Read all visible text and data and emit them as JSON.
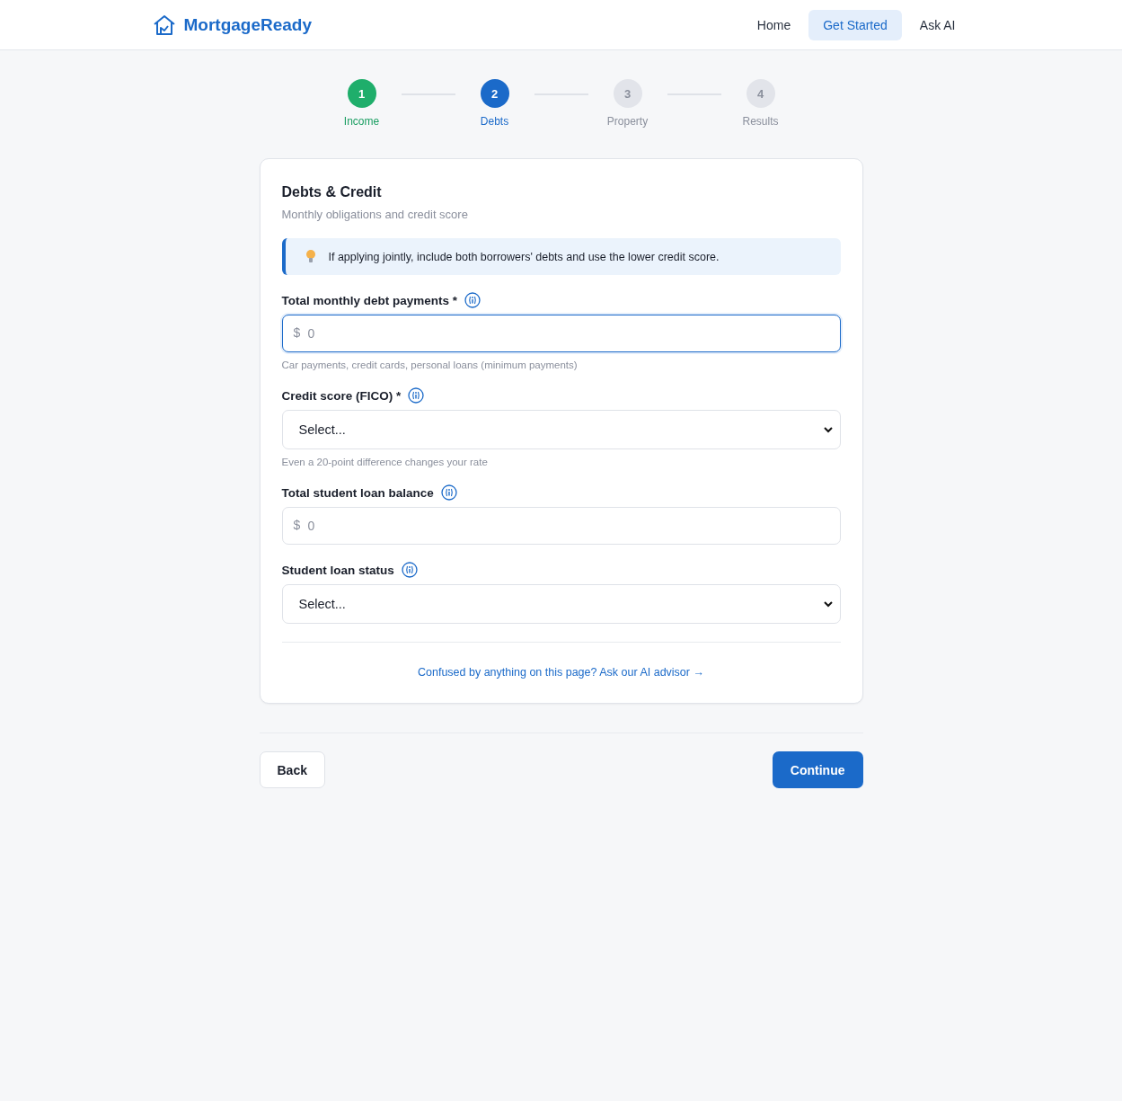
{
  "header": {
    "logo": "MortgageReady",
    "nav": [
      {
        "label": "Home",
        "selected": false
      },
      {
        "label": "Get Started",
        "selected": true
      },
      {
        "label": "Ask AI",
        "selected": false
      }
    ]
  },
  "steps": [
    {
      "number": "1",
      "label": "Income",
      "completed": true,
      "selected": false
    },
    {
      "number": "2",
      "label": "Debts",
      "completed": false,
      "selected": true
    },
    {
      "number": "3",
      "label": "Property",
      "completed": false,
      "selected": false
    },
    {
      "number": "4",
      "label": "Results",
      "completed": false,
      "selected": false
    }
  ],
  "card": {
    "title": "Debts & Credit",
    "subtitle": "Monthly obligations and credit score",
    "tip": "If applying jointly, include both borrowers' debts and use the lower credit score.",
    "fields": [
      {
        "kind": "money",
        "label": "Total monthly debt payments *",
        "prefix": "$",
        "placeholder": "0",
        "focused": true,
        "hint": "Car payments, credit cards, personal loans (minimum payments)"
      },
      {
        "kind": "select",
        "label": "Credit score (FICO) *",
        "value": "Select...",
        "focused": false,
        "hint": "Even a 20-point difference changes your rate"
      },
      {
        "kind": "money",
        "label": "Total student loan balance",
        "prefix": "$",
        "placeholder": "0",
        "focused": false
      },
      {
        "kind": "select",
        "label": "Student loan status",
        "value": "Select...",
        "focused": false
      }
    ],
    "advisor_link": "Confused by anything on this page? Ask our AI advisor →"
  },
  "buttons": {
    "back": "Back",
    "continue": "Continue"
  }
}
